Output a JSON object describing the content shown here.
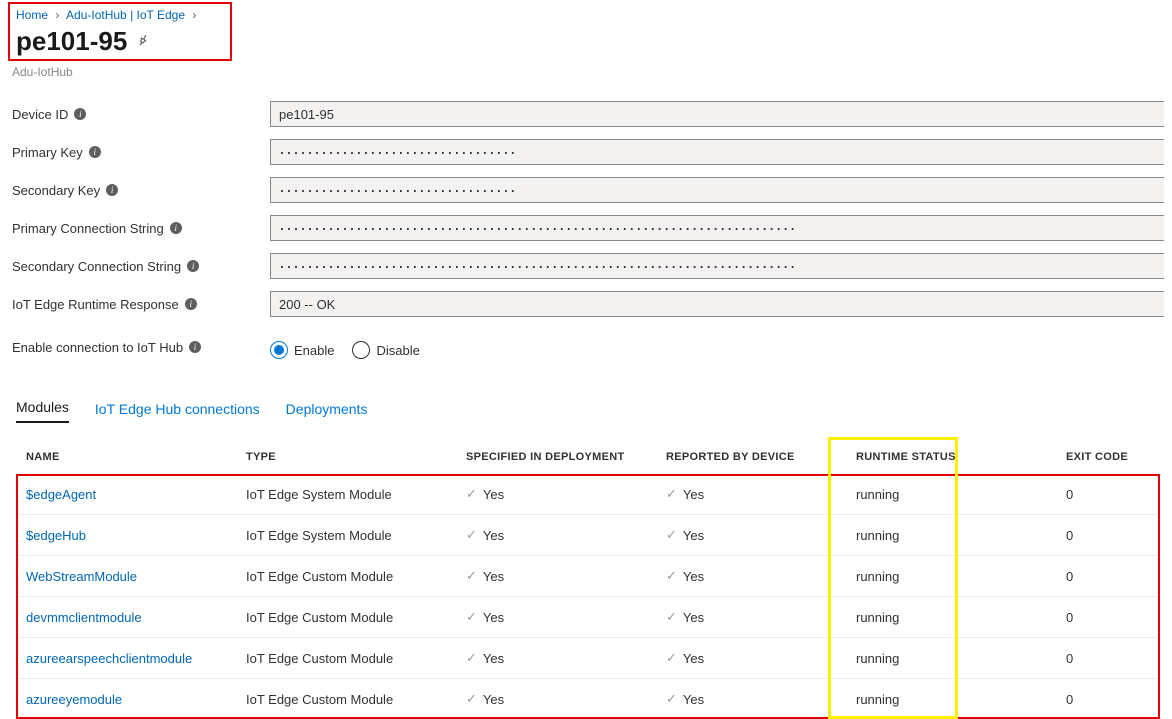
{
  "breadcrumb": {
    "home": "Home",
    "hub": "Adu-IotHub | IoT Edge"
  },
  "title": "pe101-95",
  "subtitle": "Adu-IotHub",
  "form": {
    "deviceId": {
      "label": "Device ID",
      "value": "pe101-95"
    },
    "primaryKey": {
      "label": "Primary Key",
      "value": "··································"
    },
    "secondaryKey": {
      "label": "Secondary Key",
      "value": "··································"
    },
    "primaryConn": {
      "label": "Primary Connection String",
      "value": "··········································································"
    },
    "secondaryConn": {
      "label": "Secondary Connection String",
      "value": "··········································································"
    },
    "runtime": {
      "label": "IoT Edge Runtime Response",
      "value": "200 -- OK"
    },
    "enable": {
      "label": "Enable connection to IoT Hub",
      "enable": "Enable",
      "disable": "Disable"
    }
  },
  "tabs": {
    "modules": "Modules",
    "hubconn": "IoT Edge Hub connections",
    "deploy": "Deployments"
  },
  "table": {
    "headers": {
      "name": "NAME",
      "type": "TYPE",
      "spec": "SPECIFIED IN DEPLOYMENT",
      "rep": "REPORTED BY DEVICE",
      "runtime": "RUNTIME STATUS",
      "exit": "EXIT CODE"
    },
    "yes": "Yes",
    "rows": [
      {
        "name": "$edgeAgent",
        "type": "IoT Edge System Module",
        "runtime": "running",
        "exit": "0"
      },
      {
        "name": "$edgeHub",
        "type": "IoT Edge System Module",
        "runtime": "running",
        "exit": "0"
      },
      {
        "name": "WebStreamModule",
        "type": "IoT Edge Custom Module",
        "runtime": "running",
        "exit": "0"
      },
      {
        "name": "devmmclientmodule",
        "type": "IoT Edge Custom Module",
        "runtime": "running",
        "exit": "0"
      },
      {
        "name": "azureearspeechclientmodule",
        "type": "IoT Edge Custom Module",
        "runtime": "running",
        "exit": "0"
      },
      {
        "name": "azureeyemodule",
        "type": "IoT Edge Custom Module",
        "runtime": "running",
        "exit": "0"
      }
    ]
  }
}
